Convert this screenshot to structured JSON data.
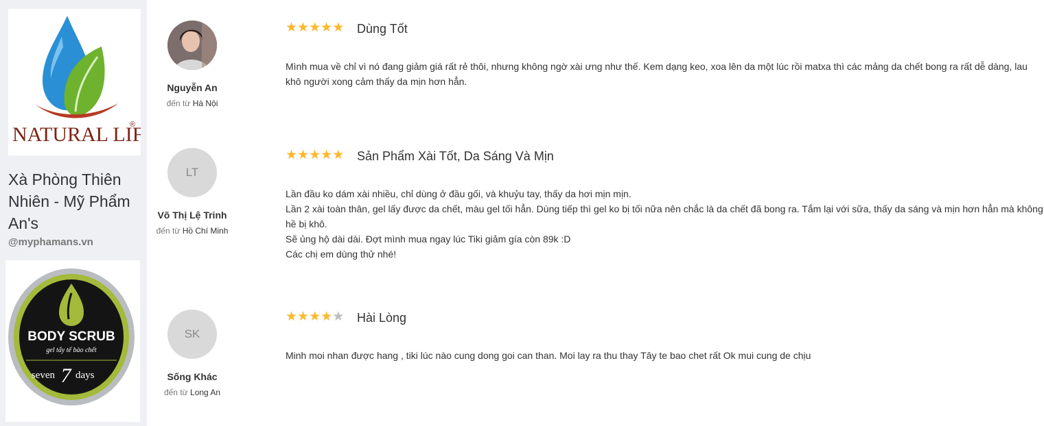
{
  "brand": {
    "logo_text": "NATURAL LIFE",
    "logo_mark": "®",
    "name": "Xà Phòng Thiên Nhiên - Mỹ Phẩm An's",
    "handle": "@myphamans.vn",
    "product_title": "BODY SCRUB",
    "product_subtitle": "gel tẩy tế bào chết",
    "product_brand_left": "seven",
    "product_brand_num": "7",
    "product_brand_right": "days"
  },
  "colors": {
    "star": "#fdb82c",
    "star_off": "#bdbdbd",
    "sidebar_bg": "#eef0f4"
  },
  "reviews": [
    {
      "name": "Nguyễn An",
      "from_label": "đến từ",
      "city": "Hà Nội",
      "initials": "",
      "rating": 5,
      "title": "Dùng Tốt",
      "content": [
        "Mình mua về chỉ vì nó đang giảm giá rất rẻ thôi, nhưng không ngờ xài ưng như thế. Kem dạng keo, xoa lên da một lúc rồi matxa thì các mảng da chết bong ra rất dễ dàng, lau khô người xong cảm thấy da mịn hơn hẳn."
      ]
    },
    {
      "name": "Võ Thị Lệ Trinh",
      "from_label": "đến từ",
      "city": "Hồ Chí Minh",
      "initials": "LT",
      "rating": 5,
      "title": "Sản Phẩm Xài Tốt, Da Sáng Và Mịn",
      "content": [
        "Lần đầu ko dám xài nhiều, chỉ dùng ở đầu gối, và khuỷu tay, thấy da hơi mịn mịn.",
        "Lần 2 xài toàn thân, gel lấy được da chết, màu gel tối hẳn. Dùng tiếp thì gel ko bị tối nữa nên chắc là da chết đã bong ra. Tắm lại với sữa, thấy da sáng và mịn hơn hẳn mà không hề bị khô.",
        "Sẽ ủng hộ dài dài. Đợt mình mua ngay lúc Tiki giảm gía còn 89k :D",
        "Các chị em dùng thử nhé!"
      ]
    },
    {
      "name": "Sống Khác",
      "from_label": "đến từ",
      "city": "Long An",
      "initials": "SK",
      "rating": 4,
      "title": "Hài Lòng",
      "content": [
        "Minh moi nhan được hang , tiki lúc nào cung dong goi can than. Moi lay ra thu thay Tây te bao chet rất Ok mui cung de chịu"
      ]
    }
  ]
}
